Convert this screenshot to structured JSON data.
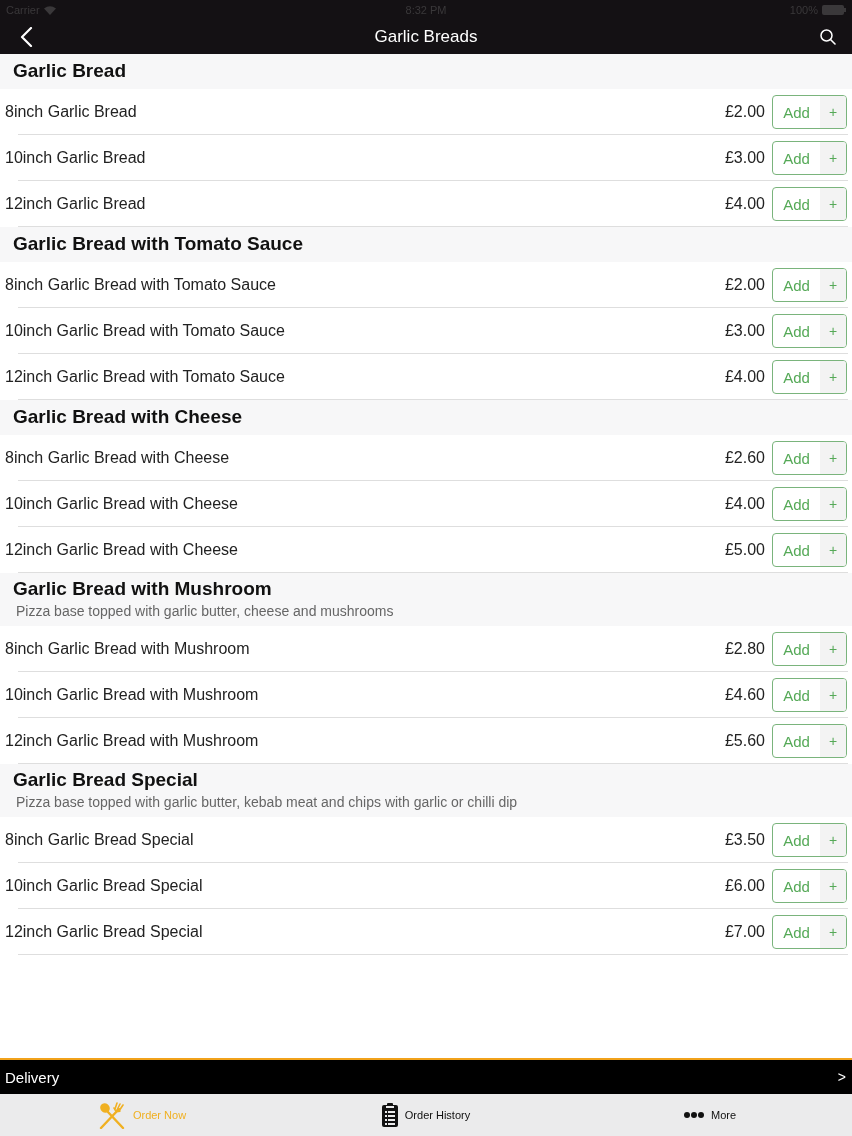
{
  "status_bar": {
    "carrier": "Carrier",
    "time": "8:32 PM",
    "battery": "100%"
  },
  "nav_bar": {
    "title": "Garlic Breads"
  },
  "sections": [
    {
      "title": "Garlic Bread",
      "items": [
        {
          "name": "8inch Garlic Bread",
          "price": "£2.00",
          "button": "Add",
          "plus": "+"
        },
        {
          "name": "10inch Garlic Bread",
          "price": "£3.00",
          "button": "Add",
          "plus": "+"
        },
        {
          "name": "12inch Garlic Bread",
          "price": "£4.00",
          "button": "Add",
          "plus": "+"
        }
      ]
    },
    {
      "title": "Garlic Bread with Tomato Sauce",
      "items": [
        {
          "name": "8inch Garlic Bread with Tomato Sauce",
          "price": "£2.00",
          "button": "Add",
          "plus": "+"
        },
        {
          "name": "10inch Garlic Bread with Tomato Sauce",
          "price": "£3.00",
          "button": "Add",
          "plus": "+"
        },
        {
          "name": "12inch Garlic Bread with Tomato Sauce",
          "price": "£4.00",
          "button": "Add",
          "plus": "+"
        }
      ]
    },
    {
      "title": "Garlic Bread with Cheese",
      "items": [
        {
          "name": "8inch Garlic Bread with Cheese",
          "price": "£2.60",
          "button": "Add",
          "plus": "+"
        },
        {
          "name": "10inch Garlic Bread with Cheese",
          "price": "£4.00",
          "button": "Add",
          "plus": "+"
        },
        {
          "name": "12inch Garlic Bread with Cheese",
          "price": "£5.00",
          "button": "Add",
          "plus": "+"
        }
      ]
    },
    {
      "title": "Garlic Bread with Mushroom",
      "description": "Pizza base topped with garlic butter, cheese and mushrooms",
      "items": [
        {
          "name": "8inch Garlic Bread with Mushroom",
          "price": "£2.80",
          "button": "Add",
          "plus": "+"
        },
        {
          "name": "10inch Garlic Bread with Mushroom",
          "price": "£4.60",
          "button": "Add",
          "plus": "+"
        },
        {
          "name": "12inch Garlic Bread with Mushroom",
          "price": "£5.60",
          "button": "Add",
          "plus": "+"
        }
      ]
    },
    {
      "title": "Garlic Bread Special",
      "description": "Pizza base topped with garlic butter, kebab meat and chips with garlic or chilli dip",
      "items": [
        {
          "name": "8inch Garlic Bread Special",
          "price": "£3.50",
          "button": "Add",
          "plus": "+"
        },
        {
          "name": "10inch Garlic Bread Special",
          "price": "£6.00",
          "button": "Add",
          "plus": "+"
        },
        {
          "name": "12inch Garlic Bread Special",
          "price": "£7.00",
          "button": "Add",
          "plus": "+"
        }
      ]
    }
  ],
  "order_bar": {
    "label": "Delivery",
    "chevron": ">"
  },
  "tab_bar": [
    {
      "kind": "utensils",
      "label": "Order Now",
      "selected": true
    },
    {
      "kind": "clipboard",
      "label": "Order History",
      "selected": false
    },
    {
      "kind": "dots",
      "label": "More",
      "selected": false
    }
  ]
}
